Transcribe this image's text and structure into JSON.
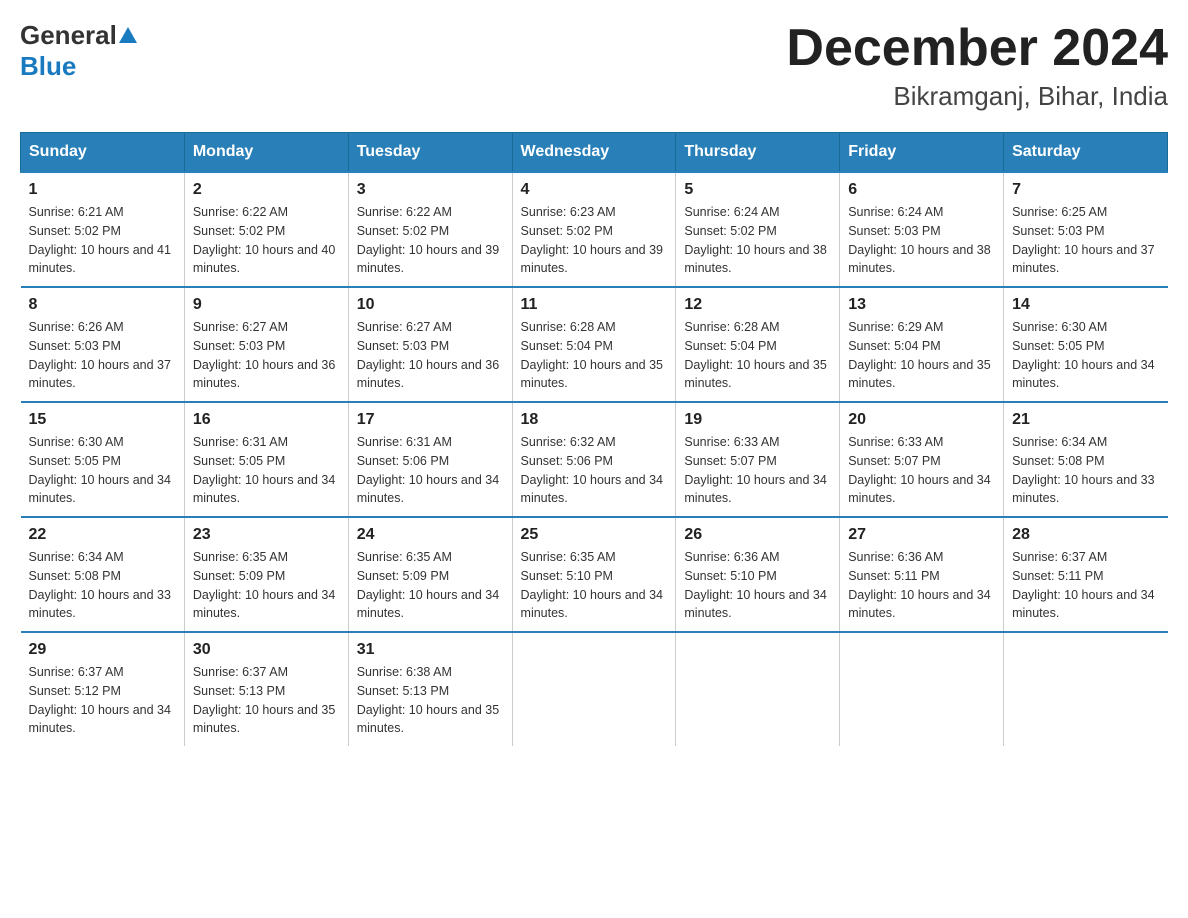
{
  "header": {
    "logo_general": "General",
    "logo_blue": "Blue",
    "month_title": "December 2024",
    "location": "Bikramganj, Bihar, India"
  },
  "days_of_week": [
    "Sunday",
    "Monday",
    "Tuesday",
    "Wednesday",
    "Thursday",
    "Friday",
    "Saturday"
  ],
  "weeks": [
    [
      {
        "day": "1",
        "sunrise": "6:21 AM",
        "sunset": "5:02 PM",
        "daylight": "10 hours and 41 minutes."
      },
      {
        "day": "2",
        "sunrise": "6:22 AM",
        "sunset": "5:02 PM",
        "daylight": "10 hours and 40 minutes."
      },
      {
        "day": "3",
        "sunrise": "6:22 AM",
        "sunset": "5:02 PM",
        "daylight": "10 hours and 39 minutes."
      },
      {
        "day": "4",
        "sunrise": "6:23 AM",
        "sunset": "5:02 PM",
        "daylight": "10 hours and 39 minutes."
      },
      {
        "day": "5",
        "sunrise": "6:24 AM",
        "sunset": "5:02 PM",
        "daylight": "10 hours and 38 minutes."
      },
      {
        "day": "6",
        "sunrise": "6:24 AM",
        "sunset": "5:03 PM",
        "daylight": "10 hours and 38 minutes."
      },
      {
        "day": "7",
        "sunrise": "6:25 AM",
        "sunset": "5:03 PM",
        "daylight": "10 hours and 37 minutes."
      }
    ],
    [
      {
        "day": "8",
        "sunrise": "6:26 AM",
        "sunset": "5:03 PM",
        "daylight": "10 hours and 37 minutes."
      },
      {
        "day": "9",
        "sunrise": "6:27 AM",
        "sunset": "5:03 PM",
        "daylight": "10 hours and 36 minutes."
      },
      {
        "day": "10",
        "sunrise": "6:27 AM",
        "sunset": "5:03 PM",
        "daylight": "10 hours and 36 minutes."
      },
      {
        "day": "11",
        "sunrise": "6:28 AM",
        "sunset": "5:04 PM",
        "daylight": "10 hours and 35 minutes."
      },
      {
        "day": "12",
        "sunrise": "6:28 AM",
        "sunset": "5:04 PM",
        "daylight": "10 hours and 35 minutes."
      },
      {
        "day": "13",
        "sunrise": "6:29 AM",
        "sunset": "5:04 PM",
        "daylight": "10 hours and 35 minutes."
      },
      {
        "day": "14",
        "sunrise": "6:30 AM",
        "sunset": "5:05 PM",
        "daylight": "10 hours and 34 minutes."
      }
    ],
    [
      {
        "day": "15",
        "sunrise": "6:30 AM",
        "sunset": "5:05 PM",
        "daylight": "10 hours and 34 minutes."
      },
      {
        "day": "16",
        "sunrise": "6:31 AM",
        "sunset": "5:05 PM",
        "daylight": "10 hours and 34 minutes."
      },
      {
        "day": "17",
        "sunrise": "6:31 AM",
        "sunset": "5:06 PM",
        "daylight": "10 hours and 34 minutes."
      },
      {
        "day": "18",
        "sunrise": "6:32 AM",
        "sunset": "5:06 PM",
        "daylight": "10 hours and 34 minutes."
      },
      {
        "day": "19",
        "sunrise": "6:33 AM",
        "sunset": "5:07 PM",
        "daylight": "10 hours and 34 minutes."
      },
      {
        "day": "20",
        "sunrise": "6:33 AM",
        "sunset": "5:07 PM",
        "daylight": "10 hours and 34 minutes."
      },
      {
        "day": "21",
        "sunrise": "6:34 AM",
        "sunset": "5:08 PM",
        "daylight": "10 hours and 33 minutes."
      }
    ],
    [
      {
        "day": "22",
        "sunrise": "6:34 AM",
        "sunset": "5:08 PM",
        "daylight": "10 hours and 33 minutes."
      },
      {
        "day": "23",
        "sunrise": "6:35 AM",
        "sunset": "5:09 PM",
        "daylight": "10 hours and 34 minutes."
      },
      {
        "day": "24",
        "sunrise": "6:35 AM",
        "sunset": "5:09 PM",
        "daylight": "10 hours and 34 minutes."
      },
      {
        "day": "25",
        "sunrise": "6:35 AM",
        "sunset": "5:10 PM",
        "daylight": "10 hours and 34 minutes."
      },
      {
        "day": "26",
        "sunrise": "6:36 AM",
        "sunset": "5:10 PM",
        "daylight": "10 hours and 34 minutes."
      },
      {
        "day": "27",
        "sunrise": "6:36 AM",
        "sunset": "5:11 PM",
        "daylight": "10 hours and 34 minutes."
      },
      {
        "day": "28",
        "sunrise": "6:37 AM",
        "sunset": "5:11 PM",
        "daylight": "10 hours and 34 minutes."
      }
    ],
    [
      {
        "day": "29",
        "sunrise": "6:37 AM",
        "sunset": "5:12 PM",
        "daylight": "10 hours and 34 minutes."
      },
      {
        "day": "30",
        "sunrise": "6:37 AM",
        "sunset": "5:13 PM",
        "daylight": "10 hours and 35 minutes."
      },
      {
        "day": "31",
        "sunrise": "6:38 AM",
        "sunset": "5:13 PM",
        "daylight": "10 hours and 35 minutes."
      },
      null,
      null,
      null,
      null
    ]
  ],
  "labels": {
    "sunrise_prefix": "Sunrise: ",
    "sunset_prefix": "Sunset: ",
    "daylight_prefix": "Daylight: "
  }
}
